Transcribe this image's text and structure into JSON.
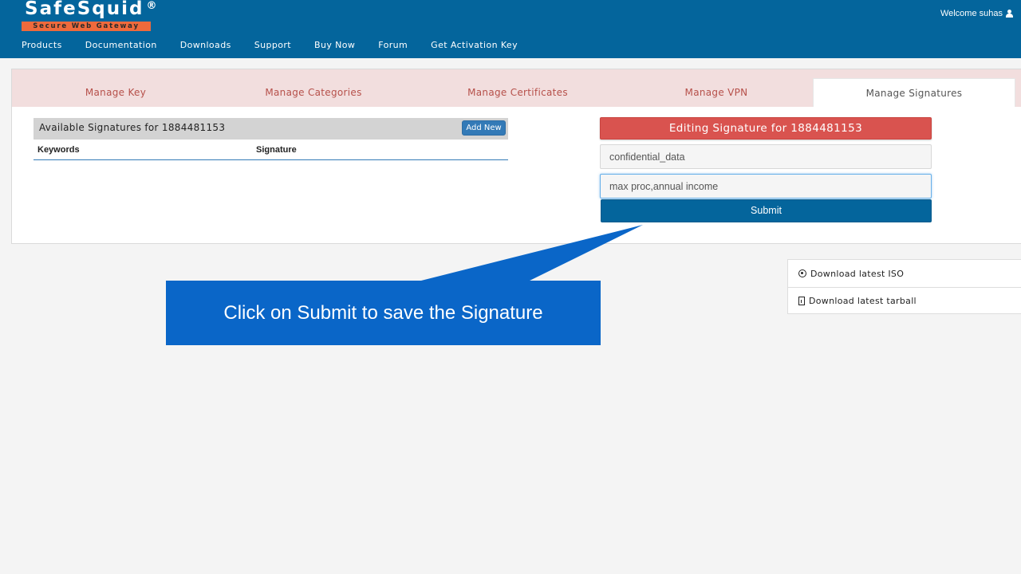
{
  "header": {
    "logo_text": "SafeSquid",
    "logo_reg": "®",
    "logo_tagline": "Secure Web Gateway",
    "welcome": "Welcome suhas",
    "user_icon": "user-icon",
    "nav": [
      "Products",
      "Documentation",
      "Downloads",
      "Support",
      "Buy Now",
      "Forum",
      "Get Activation Key"
    ]
  },
  "tabs": {
    "items": [
      "Manage Key",
      "Manage Categories",
      "Manage Certificates",
      "Manage VPN",
      "Manage Signatures"
    ],
    "active": "Manage Signatures"
  },
  "available": {
    "title": "Available Signatures for 1884481153",
    "add_new_label": "Add New",
    "columns": [
      "Keywords",
      "Signature"
    ],
    "rows": []
  },
  "editor": {
    "title": "Editing Signature for 1884481153",
    "name_value": "confidential_data",
    "keywords_value": "max proc,annual income",
    "submit_label": "Submit"
  },
  "downloads": [
    {
      "label": "Download latest ISO",
      "icon": "disc-icon"
    },
    {
      "label": "Download latest tarball",
      "icon": "file-icon"
    }
  ],
  "callout": {
    "text": "Click on Submit to save the Signature"
  },
  "colors": {
    "header_bg": "#04659c",
    "logo_bar": "#ef6a3c",
    "tabbar_bg": "#f2dede",
    "tab_text": "#b6504a",
    "edit_head": "#d9534f",
    "add_new": "#337ab7",
    "callout": "#0a66c8"
  }
}
